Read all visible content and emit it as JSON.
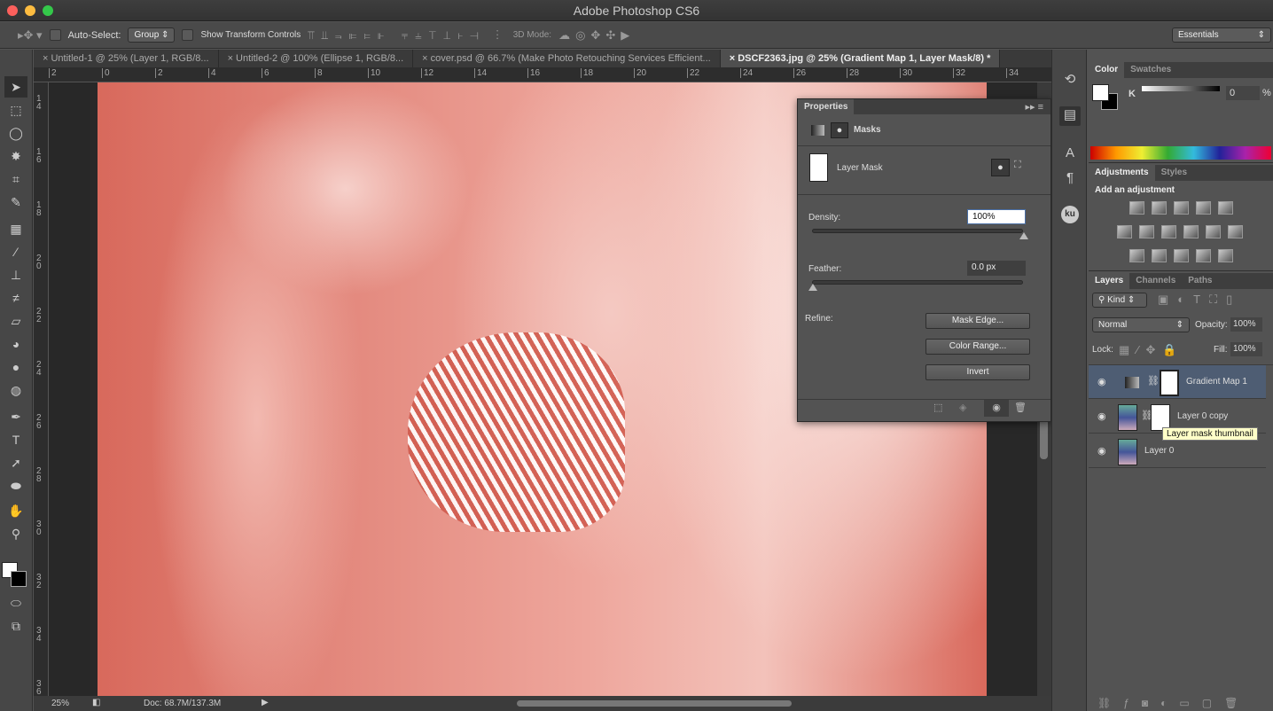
{
  "app": {
    "title": "Adobe Photoshop CS6"
  },
  "options_bar": {
    "auto_select_label": "Auto-Select:",
    "auto_select_value": "Group",
    "show_transform_label": "Show Transform Controls",
    "mode_3d_label": "3D Mode:",
    "workspace": "Essentials"
  },
  "tabs": [
    {
      "label": "Untitled-1 @ 25% (Layer 1, RGB/8..."
    },
    {
      "label": "Untitled-2 @ 100% (Ellipse 1, RGB/8..."
    },
    {
      "label": "cover.psd @ 66.7% (Make Photo Retouching Services Efficient..."
    },
    {
      "label": "DSCF2363.jpg @ 25% (Gradient Map 1, Layer Mask/8) *"
    }
  ],
  "hruler": [
    "2",
    "0",
    "2",
    "4",
    "6",
    "8",
    "10",
    "12",
    "14",
    "16",
    "18",
    "20",
    "22",
    "24",
    "26",
    "28",
    "30",
    "32",
    "34"
  ],
  "vruler": [
    "14",
    "16",
    "18",
    "20",
    "22",
    "24",
    "26",
    "28",
    "30",
    "32",
    "34",
    "36"
  ],
  "status": {
    "zoom": "25%",
    "doc": "Doc: 68.7M/137.3M"
  },
  "properties": {
    "title": "Properties",
    "section": "Masks",
    "mask_label": "Layer Mask",
    "density_label": "Density:",
    "density_value": "100%",
    "density": 100,
    "feather_label": "Feather:",
    "feather_value": "0.0 px",
    "feather": 0,
    "refine_label": "Refine:",
    "mask_edge": "Mask Edge...",
    "color_range": "Color Range...",
    "invert": "Invert"
  },
  "color_panel": {
    "tabs": [
      "Color",
      "Swatches"
    ],
    "channel": "K",
    "value": "0",
    "unit": "%"
  },
  "adjustments": {
    "tabs": [
      "Adjustments",
      "Styles"
    ],
    "heading": "Add an adjustment"
  },
  "layers_panel": {
    "tabs": [
      "Layers",
      "Channels",
      "Paths"
    ],
    "filter": "Kind",
    "blend": "Normal",
    "opacity_label": "Opacity:",
    "opacity": "100%",
    "lock_label": "Lock:",
    "fill_label": "Fill:",
    "fill": "100%",
    "layers": [
      {
        "name": "Gradient Map 1",
        "selected": true
      },
      {
        "name": "Layer 0 copy"
      },
      {
        "name": "Layer 0"
      }
    ],
    "tooltip": "Layer mask thumbnail"
  },
  "dock": {
    "ku": "ku"
  },
  "colors": {
    "accent_selected": "#4e5d73",
    "photo_tint": "#d9675a"
  }
}
